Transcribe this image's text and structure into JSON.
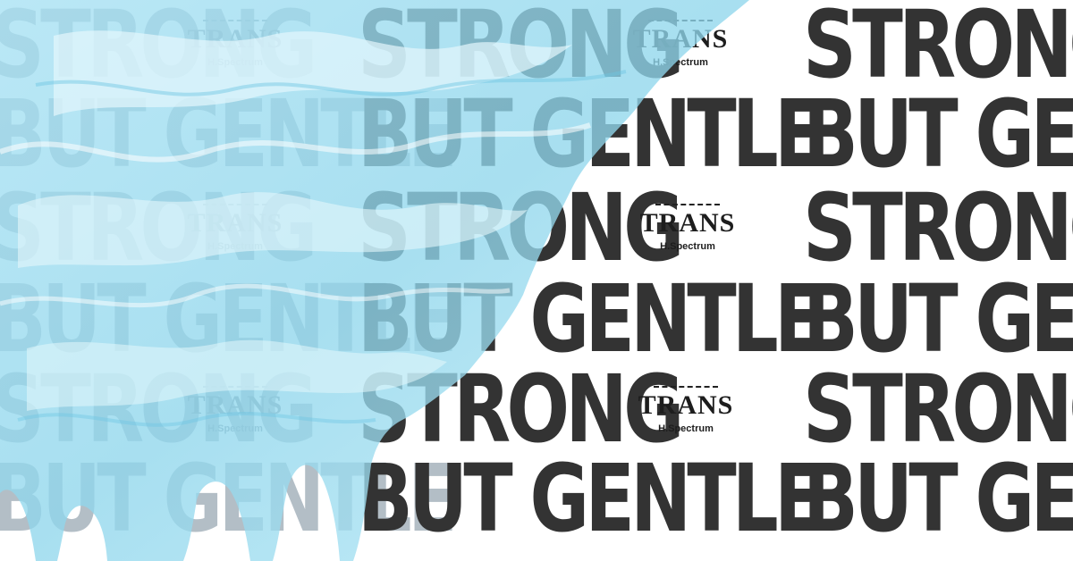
{
  "artwork": {
    "phrase_line_1": "STRONG",
    "phrase_line_2": "BUT GENTLE",
    "colors": {
      "text_dark": "#333333",
      "text_faded": "#9aa9b4",
      "liquid_blue": "#8fd6ec",
      "liquid_light": "#c9eef8",
      "background": "#ffffff"
    }
  },
  "logo": {
    "word": "TRANS",
    "subtitle": "H.Spectrum",
    "icon": "dashed-rule-icon"
  }
}
